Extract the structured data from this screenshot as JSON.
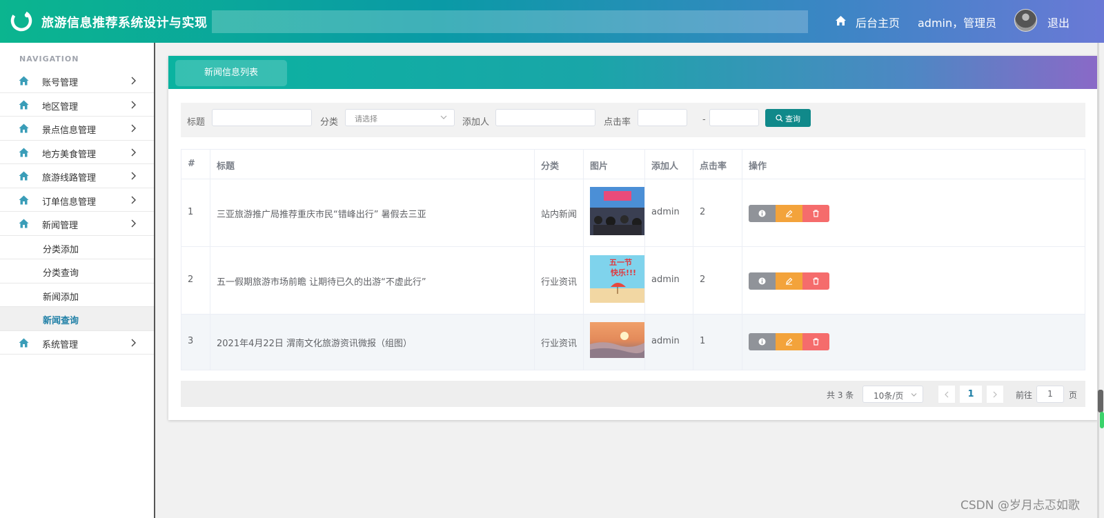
{
  "header": {
    "app_title": "旅游信息推荐系统设计与实现",
    "home_link": "后台主页",
    "user_label": "admin，管理员",
    "logout": "退出"
  },
  "sidebar": {
    "heading": "NAVIGATION",
    "items": [
      {
        "label": "账号管理"
      },
      {
        "label": "地区管理"
      },
      {
        "label": "景点信息管理"
      },
      {
        "label": "地方美食管理"
      },
      {
        "label": "旅游线路管理"
      },
      {
        "label": "订单信息管理"
      },
      {
        "label": "新闻管理"
      }
    ],
    "sub_items": [
      {
        "label": "分类添加"
      },
      {
        "label": "分类查询"
      },
      {
        "label": "新闻添加"
      },
      {
        "label": "新闻查询"
      }
    ],
    "last_item": {
      "label": "系统管理"
    }
  },
  "card": {
    "tab": "新闻信息列表"
  },
  "filter": {
    "title_label": "标题",
    "category_label": "分类",
    "category_placeholder": "请选择",
    "adder_label": "添加人",
    "clicks_label": "点击率",
    "range_dash": "-",
    "search_button": "查询"
  },
  "table": {
    "headers": [
      "#",
      "标题",
      "分类",
      "图片",
      "添加人",
      "点击率",
      "操作"
    ],
    "rows": [
      {
        "no": "1",
        "title": "三亚旅游推广局推荐重庆市民“错峰出行” 暑假去三亚",
        "category": "站内新闻",
        "adder": "admin",
        "clicks": "2"
      },
      {
        "no": "2",
        "title": "五一假期旅游市场前瞻 让期待已久的出游“不虚此行”",
        "category": "行业资讯",
        "adder": "admin",
        "clicks": "2"
      },
      {
        "no": "3",
        "title": "2021年4月22日 渭南文化旅游资讯微报（组图）",
        "category": "行业资讯",
        "adder": "admin",
        "clicks": "1"
      }
    ]
  },
  "pagination": {
    "total": "共 3 条",
    "page_size": "10条/页",
    "current_page": "1",
    "goto_label": "前往",
    "goto_value": "1",
    "page_suffix": "页"
  },
  "watermark": "CSDN @岁月忐忑如歌",
  "colors": {
    "accent": "#10898a",
    "edit": "#f3a33b",
    "delete": "#f56c6c",
    "view": "#909399",
    "active_menu": "#1e7fa6"
  }
}
